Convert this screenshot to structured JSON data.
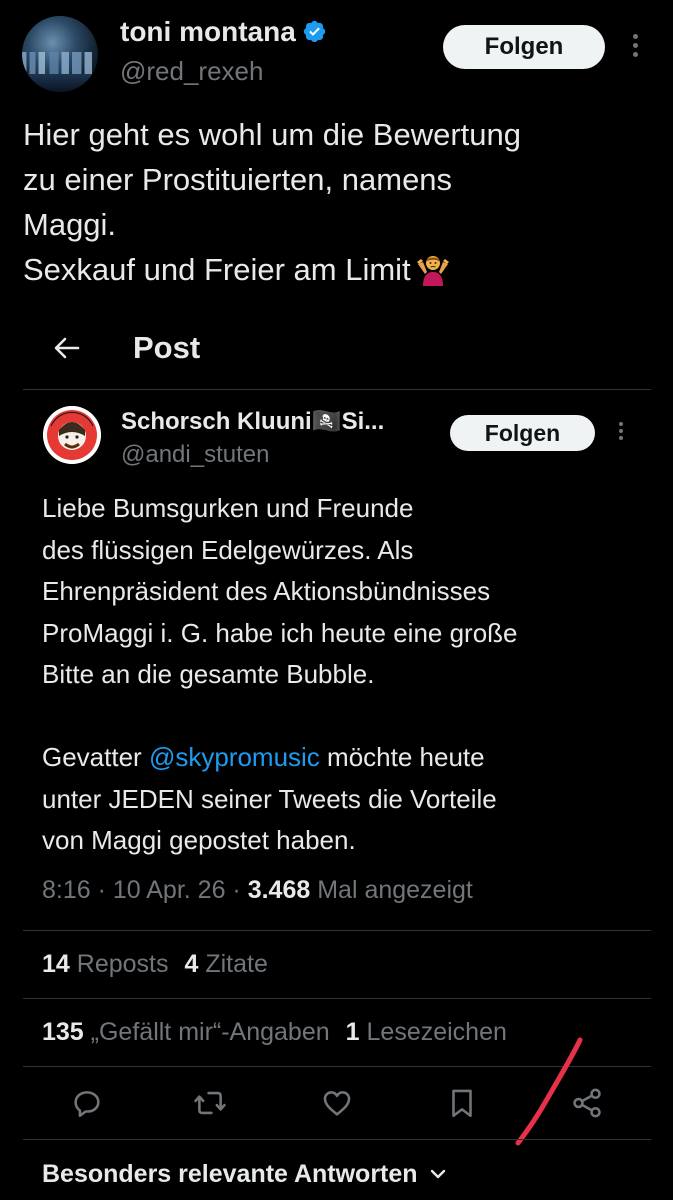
{
  "outer_post": {
    "author_name": "toni montana",
    "author_handle": "@red_rexeh",
    "follow_label": "Folgen",
    "text_lines": [
      "Hier geht es wohl um die Bewertung",
      "zu einer Prostituierten, namens",
      "Maggi.",
      "Sexkauf und Freier am Limit"
    ],
    "emoji": "person-shrugging"
  },
  "screenshot_header": {
    "title": "Post"
  },
  "quoted_post": {
    "author_name": "Schorsch Kluuni🏴‍☠️Si...",
    "author_handle": "@andi_stuten",
    "follow_label": "Folgen",
    "text_lines": [
      "Liebe Bumsgurken und Freunde",
      "des flüssigen Edelgewürzes. Als",
      "Ehrenpräsident des Aktionsbündnisses",
      "ProMaggi i. G. habe ich heute eine große",
      "Bitte an die gesamte Bubble."
    ],
    "text2_prefix": "Gevatter ",
    "text2_mention": "@skypromusic",
    "text2_suffix": " möchte heute",
    "text2_lines": [
      "unter JEDEN seiner Tweets die Vorteile",
      "von Maggi gepostet haben."
    ],
    "time": "8:16 · 10 Apr. 26 · ",
    "views_count": "3.468",
    "views_label": " Mal angezeigt",
    "reposts_count": "14",
    "reposts_label": " Reposts",
    "quotes_count": "4",
    "quotes_label": " Zitate",
    "likes_count": "135",
    "likes_label": " „Gefällt mir“-Angaben",
    "bookmarks_count": "1",
    "bookmarks_label": " Lesezeichen",
    "replies_sort_label": "Besonders relevante Antworten"
  },
  "colors": {
    "background": "#000000",
    "text": "#e7e9ea",
    "muted": "#71767b",
    "link": "#1d9bf0",
    "verified": "#1d9bf0",
    "annotation": "#e8304a"
  },
  "icons": [
    "verified-badge-icon",
    "more-icon",
    "back-arrow-icon",
    "reply-icon",
    "repost-icon",
    "like-icon",
    "bookmark-icon",
    "share-icon",
    "chevron-down-icon"
  ]
}
